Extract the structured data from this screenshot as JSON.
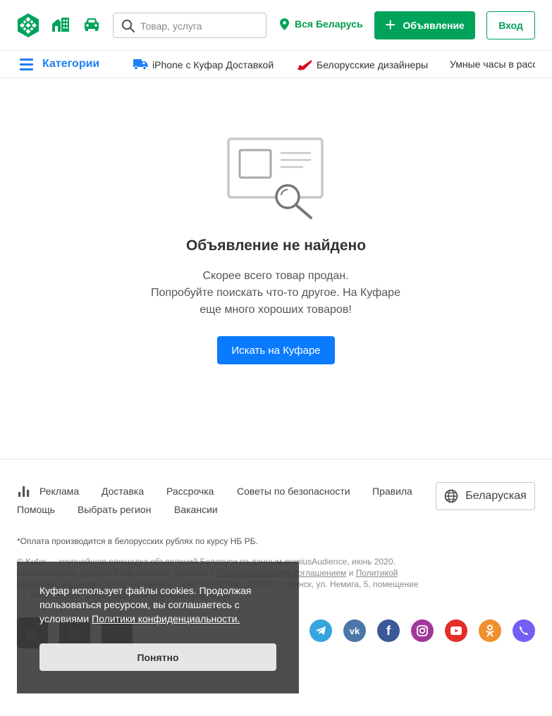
{
  "header": {
    "logo_icon": "kufar-logo-icon",
    "realty_icon": "realty-icon",
    "auto_icon": "car-icon",
    "search_placeholder": "Товар, услуга",
    "region_label": "Вся Беларусь",
    "post_button_label": "Объявление",
    "login_button_label": "Вход"
  },
  "categories": {
    "toggle_label": "Категории",
    "links": [
      {
        "label": "iPhone с Куфар Доставкой",
        "icon": "delivery-truck-icon"
      },
      {
        "label": "Белорусские дизайнеры",
        "icon": "high-heel-shoe-icon"
      },
      {
        "label": "Умные часы в расс",
        "icon": ""
      }
    ]
  },
  "empty_state": {
    "illustration_icon": "ad-search-illustration",
    "title": "Объявление не найдено",
    "subtitle_line1": "Скорее всего товар продан.",
    "subtitle_line2": "Попробуйте поискать что-то другое. На Куфаре",
    "subtitle_line3": "еще много хороших товаров!",
    "button_label": "Искать на Куфаре"
  },
  "footer": {
    "links_row1": [
      "Реклама",
      "Доставка",
      "Рассрочка",
      "Советы по безопасности",
      "Правила"
    ],
    "links_row2": [
      "Помощь",
      "Выбрать регион",
      "Вакансии"
    ],
    "language_button": "Беларуская",
    "payment_note": "*Оплата производится в белорусских рублях по курсу НБ РБ.",
    "legal_part1": "© Kufar — крупнейшая площадка объявлений Беларуси по данным gemiusAudience, июнь 2020. Использование ресурса Kufar означает согласие с ",
    "legal_link1": "Пользовательским соглашением",
    "legal_part2": " и ",
    "legal_link2": "Политикой конфиденциальности",
    "legal_part3": ". ООО «Адевинта», УНП 191767445, 220030, г. Минск, ул. Немига, 5, помещение 77. Регистрация: 15.09.2012 Минским горисполкомом.",
    "stores": [
      "apple-store-icon",
      "google-play-icon",
      "huawei-appgallery-icon"
    ],
    "socials": [
      "telegram-icon",
      "vk-icon",
      "facebook-icon",
      "instagram-icon",
      "youtube-icon",
      "odnoklassniki-icon",
      "viber-icon"
    ]
  },
  "cookie_banner": {
    "text": "Куфар использует файлы cookies. Продолжая пользоваться ресурсом, вы соглашаетесь с условиями ",
    "link": "Политики конфиденциальности.",
    "button_label": "Понятно"
  },
  "colors": {
    "brand_green": "#01a35b",
    "link_blue": "#1f7ff2",
    "cta_blue": "#0a7bff"
  }
}
